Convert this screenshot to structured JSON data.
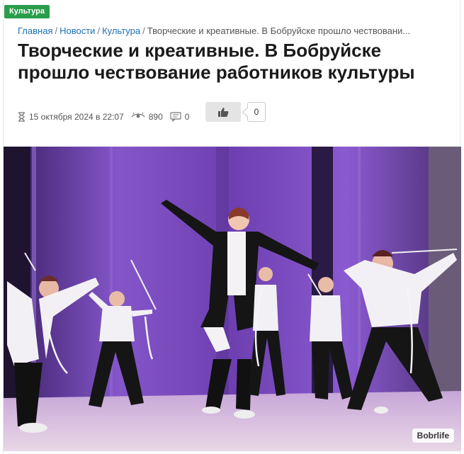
{
  "category_tag": "Культура",
  "breadcrumb": {
    "items": [
      "Главная",
      "Новости",
      "Культура"
    ],
    "current": "Творческие и креативные. В Бобруйске прошло чествовани..."
  },
  "article": {
    "title": "Творческие и креативные. В Бобруйске прошло чествование работников культуры",
    "date": "15 октября 2024 в 22:07",
    "views": "890",
    "comments": "0",
    "likes": "0"
  },
  "photo": {
    "watermark": "Bobrlife"
  },
  "colors": {
    "accent_green": "#2a9d4b",
    "link_blue": "#1c6fb8",
    "stage_purple": "#8a4fc7"
  },
  "icons": [
    "hourglass-icon",
    "eye-icon",
    "comment-icon",
    "thumbs-up-icon"
  ]
}
